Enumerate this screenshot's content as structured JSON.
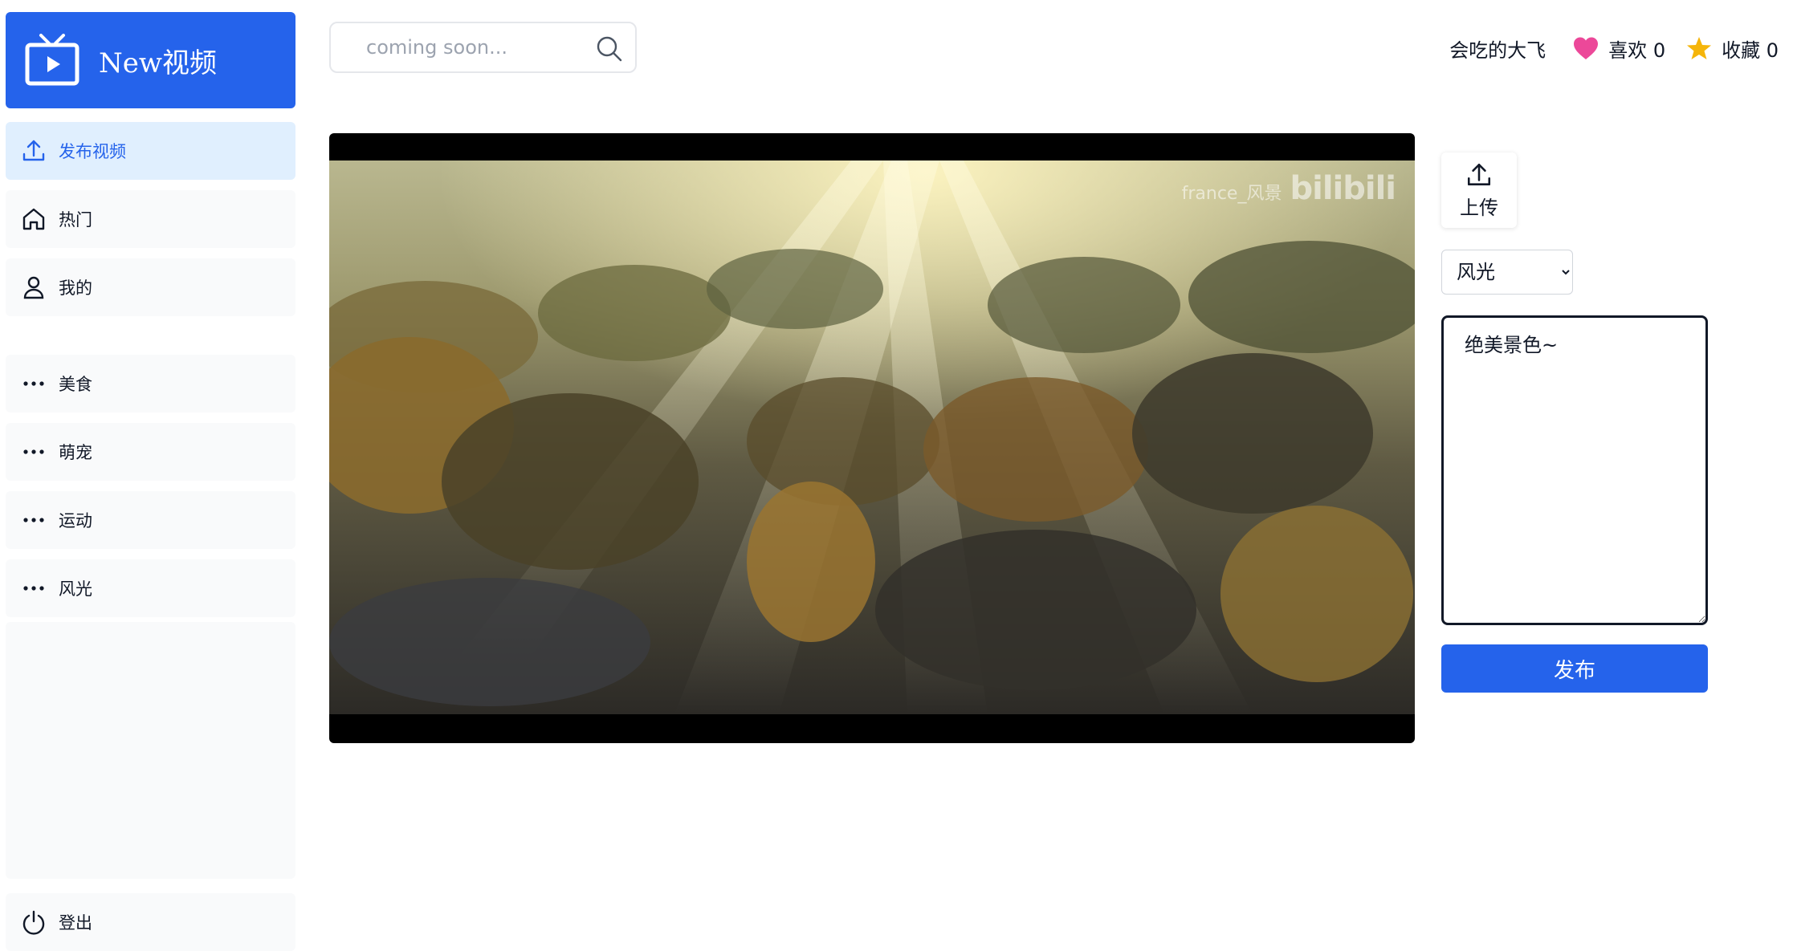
{
  "app": {
    "title": "New视频"
  },
  "sidebar": {
    "items": [
      {
        "label": "发布视频",
        "icon": "upload-icon",
        "active": true
      },
      {
        "label": "热门",
        "icon": "home-icon"
      },
      {
        "label": "我的",
        "icon": "user-icon"
      },
      {
        "label": "美食",
        "icon": "more-dots-icon"
      },
      {
        "label": "萌宠",
        "icon": "more-dots-icon"
      },
      {
        "label": "运动",
        "icon": "more-dots-icon"
      },
      {
        "label": "风光",
        "icon": "more-dots-icon"
      },
      {
        "label": "登出",
        "icon": "power-icon"
      }
    ]
  },
  "search": {
    "placeholder": "coming soon..."
  },
  "header": {
    "username": "会吃的大飞",
    "likes_label": "喜欢 0",
    "favorites_label": "收藏 0"
  },
  "video": {
    "watermark_text": "france_风景",
    "watermark_logo": "bilibili"
  },
  "upload": {
    "label": "上传"
  },
  "category": {
    "selected": "风光",
    "options": [
      "风光"
    ]
  },
  "description": {
    "value": "绝美景色~"
  },
  "publish": {
    "label": "发布"
  },
  "colors": {
    "accent": "#2563eb",
    "active_bg": "#e0effe",
    "sidebar_bg": "#f9fafb",
    "like": "#ec4899",
    "favorite": "#f5b50a"
  }
}
